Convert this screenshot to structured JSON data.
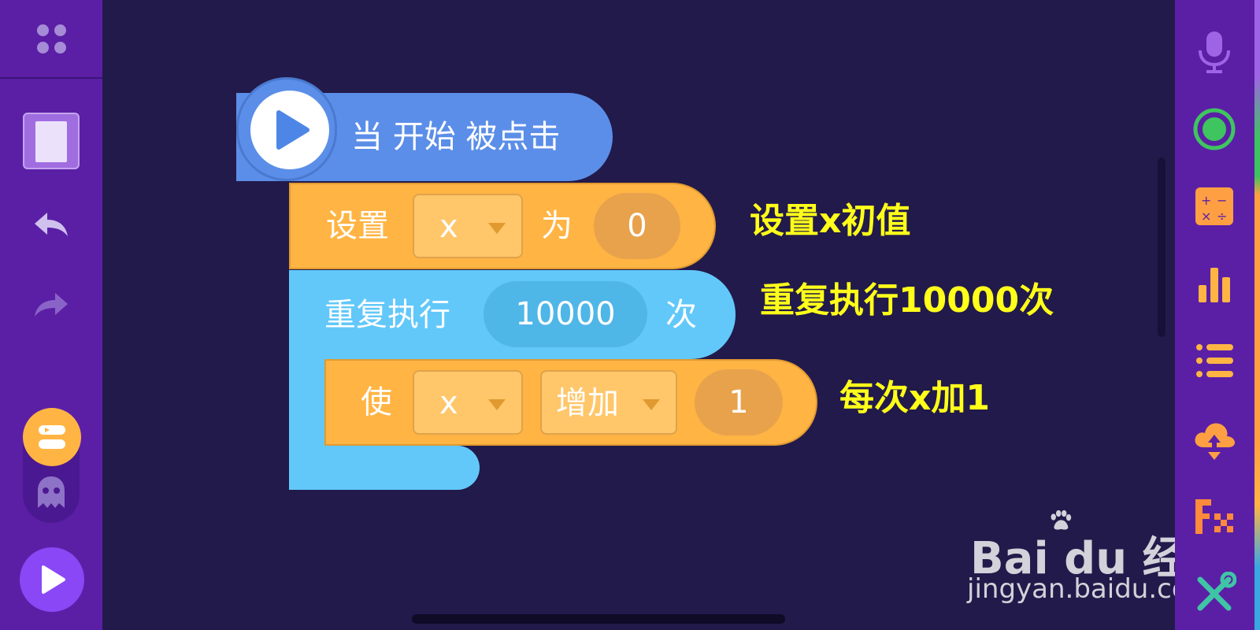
{
  "blocks": {
    "hat_label": "当 开始 被点击",
    "set": {
      "label": "设置",
      "var": "x",
      "to": "为",
      "value": "0"
    },
    "repeat": {
      "label": "重复执行",
      "count": "10000",
      "suffix": "次"
    },
    "change": {
      "label": "使",
      "var": "x",
      "op": "增加",
      "value": "1"
    }
  },
  "annotations": {
    "set": "设置x初值",
    "repeat": "重复执行10000次",
    "change": "每次x加1"
  },
  "watermark": {
    "brand": "Bai du 经验",
    "url": "jingyan.baidu.com"
  },
  "colors": {
    "background": "#221a4a",
    "toolbar": "#5b1fa6",
    "event_block": "#5b8ee8",
    "variable_block": "#ffb444",
    "control_block": "#62c8fa",
    "annotation_text": "#ffff1a"
  },
  "icons": {
    "left": [
      "grid-icon",
      "stage-thumbnail",
      "undo-icon",
      "redo-icon",
      "sprite-icon",
      "ghost-sprite-icon",
      "play-icon"
    ],
    "right": [
      "microphone-icon",
      "record-icon",
      "calculator-icon",
      "bar-chart-icon",
      "list-icon",
      "cloud-upload-icon",
      "effects-icon",
      "tools-icon"
    ]
  }
}
